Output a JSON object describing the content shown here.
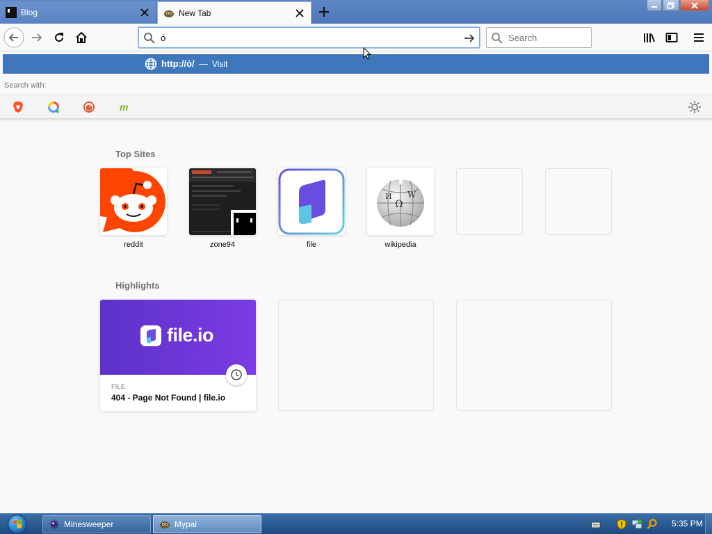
{
  "tabs": [
    {
      "title": "Blog",
      "active": false,
      "icon": "terminal-favicon-icon"
    },
    {
      "title": "New Tab",
      "active": true,
      "icon": "mypal-favicon-icon"
    }
  ],
  "window_controls": {
    "minimize": "minimize-icon",
    "maximize": "restore-icon",
    "close": "close-icon"
  },
  "navbar": {
    "back": "back-arrow-icon",
    "forward": "forward-arrow-icon",
    "reload": "reload-icon",
    "home": "home-icon",
    "url_value": "ó",
    "search_placeholder": "Search",
    "library": "library-icon",
    "sidebar": "sidebar-icon",
    "menu": "hamburger-menu-icon"
  },
  "dropdown": {
    "suggestion_url": "http://ó/",
    "suggestion_separator": "—",
    "suggestion_action": "Visit",
    "search_with_label": "Search with:",
    "engines": [
      "brave-icon",
      "qwant-icon",
      "duckduckgo-icon",
      "mojeek-icon"
    ],
    "settings": "gear-icon"
  },
  "top_sites": {
    "heading": "Top Sites",
    "sites": [
      {
        "label": "reddit",
        "icon": "reddit-icon"
      },
      {
        "label": "zone94",
        "icon": "zone94-thumbnail"
      },
      {
        "label": "file",
        "icon": "file-io-icon"
      },
      {
        "label": "wikipedia",
        "icon": "wikipedia-icon"
      },
      {
        "label": "",
        "icon": ""
      },
      {
        "label": "",
        "icon": ""
      }
    ]
  },
  "highlights": {
    "heading": "Highlights",
    "cards": [
      {
        "brand": "file.io",
        "type": "FILE",
        "title": "404 - Page Not Found | file.io",
        "icon": "clock-icon"
      }
    ]
  },
  "taskbar": {
    "items": [
      {
        "label": "Minesweeper",
        "icon": "minesweeper-icon"
      },
      {
        "label": "Mypal",
        "icon": "mypal-icon"
      }
    ],
    "clock": "5:35 PM",
    "tray_icons": [
      "keyboard-icon",
      "security-shield-icon",
      "network-icon",
      "search-tray-icon"
    ]
  },
  "colors": {
    "accent": "#3f77bc",
    "file_io_purple": "#6a36d8",
    "reddit": "#ff4500"
  }
}
